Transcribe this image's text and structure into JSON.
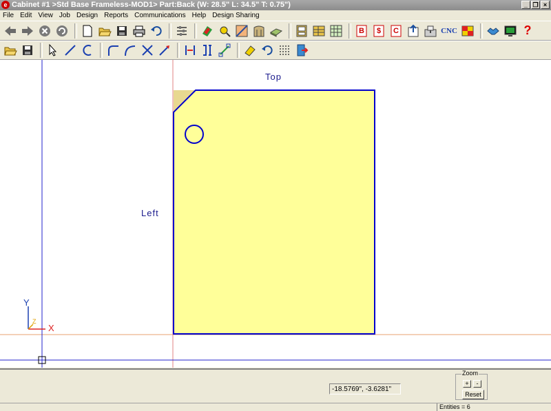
{
  "window": {
    "title": "Cabinet #1 >Std Base Frameless-MOD1> Part:Back (W: 28.5\" L: 34.5\" T: 0.75\")",
    "app_icon": "e",
    "minimize": "_",
    "restore": "❐",
    "close": "×"
  },
  "menu": [
    "File",
    "Edit",
    "View",
    "Job",
    "Design",
    "Reports",
    "Communications",
    "Help",
    "Design Sharing"
  ],
  "toolbar1": {
    "cnc_label": "CNC",
    "report_b": "B",
    "report_dollar": "$",
    "report_c": "C",
    "help": "?"
  },
  "canvas": {
    "label_top": "Top",
    "label_left": "Left",
    "axis_y": "Y",
    "axis_x": "X",
    "axis_z": "Z"
  },
  "part": {
    "fill_color": "#ffff99",
    "outline_color": "#0000cc",
    "width_in": 28.5,
    "length_in": 34.5,
    "thickness_in": 0.75
  },
  "coords": "-18.5769\", -3.6281\"",
  "zoom": {
    "title": "Zoom",
    "plus": "+",
    "minus": "-",
    "reset": "Reset"
  },
  "status": {
    "entities": "Entities =  6"
  }
}
